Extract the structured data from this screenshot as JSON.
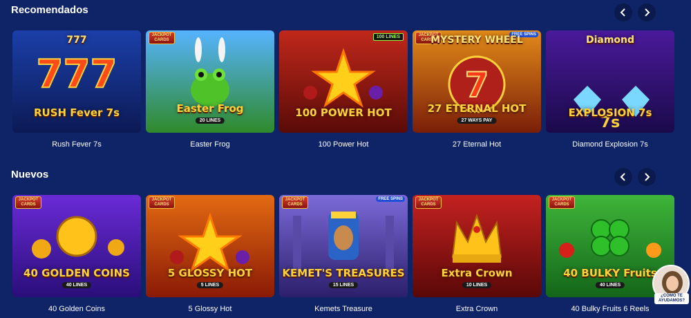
{
  "sections": [
    {
      "title": "Recomendados",
      "games": [
        {
          "label": "Rush Fever 7s",
          "art_line1": "777",
          "art_line2": "RUSH Fever 7s",
          "badge": "",
          "sub": "",
          "bg1": "#1b3fa8",
          "bg2": "#0c1a55",
          "icon": "sevens"
        },
        {
          "label": "Easter Frog",
          "art_line1": "",
          "art_line2": "Easter Frog",
          "badge": "JACKPOT CARDS",
          "sub": "20 LINES",
          "bg1": "#56b3ff",
          "bg2": "#2f8a2a",
          "icon": "frog"
        },
        {
          "label": "100 Power Hot",
          "art_line1": "",
          "art_line2": "100 POWER HOT",
          "badge": "",
          "sub": "",
          "lines": "100 LINES",
          "bg1": "#c0281b",
          "bg2": "#5a0b08",
          "icon": "star"
        },
        {
          "label": "27 Eternal Hot",
          "art_line1": "MYSTERY WHEEL",
          "art_line2": "27 ETERNAL HOT",
          "badge": "JACKPOT CARDS",
          "sub": "27 WAYS PAY",
          "free": "FREE SPINS",
          "bg1": "#e28a1a",
          "bg2": "#7a1e08",
          "icon": "seven"
        },
        {
          "label": "Diamond Explosion 7s",
          "art_line1": "Diamond",
          "art_line2": "EXPLOSION 7s",
          "badge": "",
          "sub": "",
          "bg1": "#4a1a9a",
          "bg2": "#1a0a4a",
          "icon": "diamond"
        }
      ]
    },
    {
      "title": "Nuevos",
      "games": [
        {
          "label": "40 Golden Coins",
          "art_line1": "",
          "art_line2": "40 GOLDEN COINS",
          "badge": "JACKPOT CARDS",
          "sub": "40 LINES",
          "bg1": "#6a2bd6",
          "bg2": "#2a0e7a",
          "icon": "coin"
        },
        {
          "label": "5 Glossy Hot",
          "art_line1": "",
          "art_line2": "5 GLOSSY HOT",
          "badge": "JACKPOT CARDS",
          "sub": "5 LINES",
          "bg1": "#e36a12",
          "bg2": "#8a1a06",
          "icon": "star"
        },
        {
          "label": "Kemets Treasure",
          "art_line1": "",
          "art_line2": "KEMET'S TREASURES",
          "badge": "JACKPOT CARDS",
          "sub": "15 LINES",
          "free": "FREE SPINS",
          "bg1": "#7b6ad8",
          "bg2": "#2c1f6b",
          "icon": "pharaoh"
        },
        {
          "label": "Extra Crown",
          "art_line1": "",
          "art_line2": "Extra Crown",
          "badge": "JACKPOT CARDS",
          "sub": "10 LINES",
          "bg1": "#c42220",
          "bg2": "#5a0808",
          "icon": "crown"
        },
        {
          "label": "40 Bulky Fruits 6 Reels",
          "art_line1": "",
          "art_line2": "40 BULKY Fruits",
          "badge": "JACKPOT CARDS",
          "sub": "40 LINES",
          "bg1": "#3fb53a",
          "bg2": "#14661a",
          "icon": "clover"
        }
      ]
    }
  ],
  "nav": {
    "prev_icon": "chevron-left-icon",
    "next_icon": "chevron-right-icon"
  },
  "assistant": {
    "label": "¿COMO TE AYUDAMOS?"
  },
  "colors": {
    "background": "#0f2466",
    "nav_button": "#0a1a4d",
    "text": "#ffffff"
  }
}
